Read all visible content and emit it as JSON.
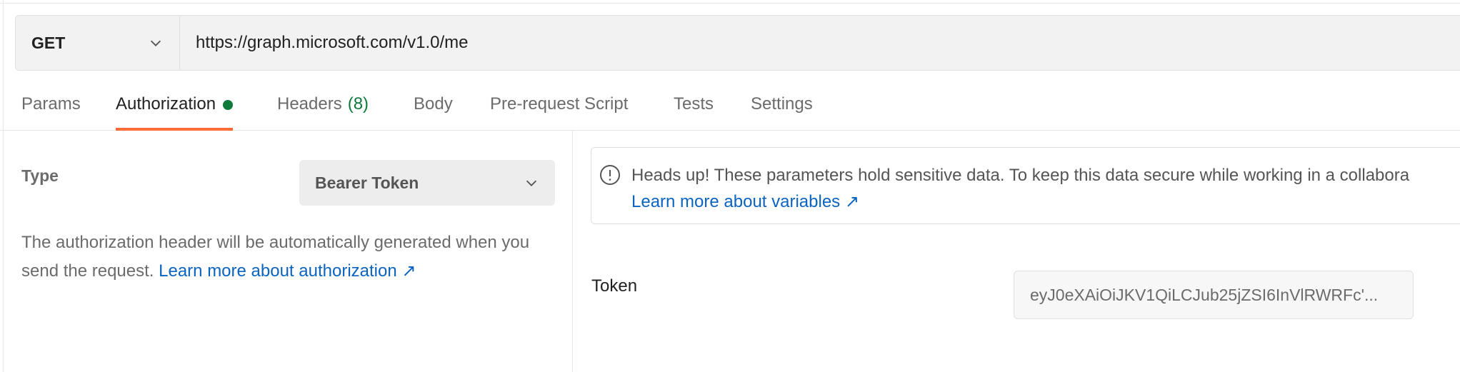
{
  "request": {
    "method": "GET",
    "url": "https://graph.microsoft.com/v1.0/me"
  },
  "tabs": [
    {
      "label": "Params"
    },
    {
      "label": "Authorization",
      "active": true,
      "status_dot": true
    },
    {
      "label": "Headers",
      "count": "(8)"
    },
    {
      "label": "Body"
    },
    {
      "label": "Pre-request Script"
    },
    {
      "label": "Tests"
    },
    {
      "label": "Settings"
    }
  ],
  "auth": {
    "type_label": "Type",
    "type_value": "Bearer Token",
    "description": "The authorization header will be automatically generated when you send the request.",
    "learn_more": "Learn more about authorization ↗"
  },
  "info": {
    "text": "Heads up! These parameters hold sensitive data. To keep this data secure while working in a collabora",
    "learn_more": "Learn more about variables ↗"
  },
  "token": {
    "label": "Token",
    "value": "eyJ0eXAiOiJKV1QiLCJub25jZSI6InVlRWRFc'..."
  },
  "colors": {
    "accent_tab": "#ff6c37",
    "status_green": "#0e7a3b",
    "link_blue": "#0b64c0"
  },
  "icons": [
    "chevron-down-icon",
    "info-circle-icon",
    "external-link-icon"
  ]
}
